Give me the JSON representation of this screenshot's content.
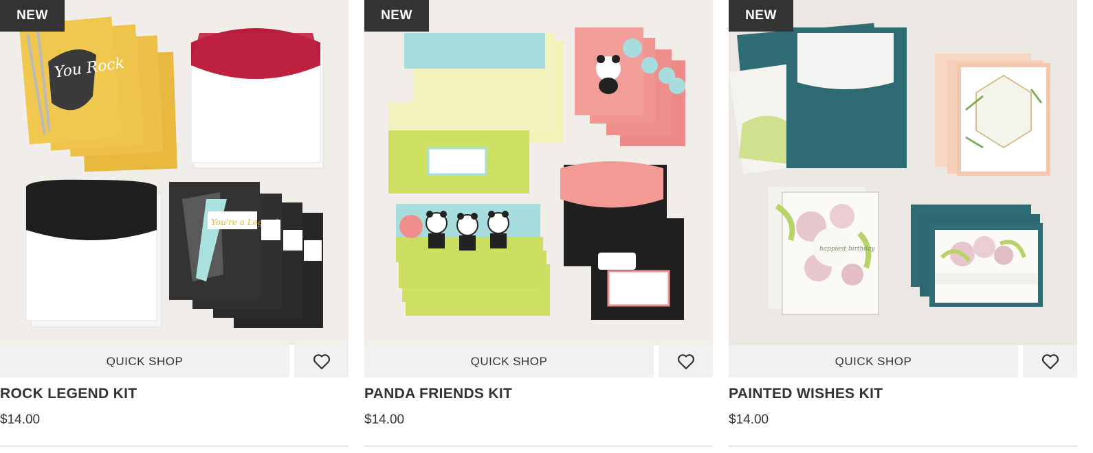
{
  "products": [
    {
      "badge": "NEW",
      "quick_shop": "QUICK SHOP",
      "name": "ROCK LEGEND KIT",
      "price": "$14.00"
    },
    {
      "badge": "NEW",
      "quick_shop": "QUICK SHOP",
      "name": "PANDA FRIENDS KIT",
      "price": "$14.00"
    },
    {
      "badge": "NEW",
      "quick_shop": "QUICK SHOP",
      "name": "PAINTED WISHES KIT",
      "price": "$14.00"
    }
  ],
  "icons": {
    "wishlist": "heart-outline-icon"
  },
  "colors": {
    "badge_bg": "#333333",
    "button_bg": "#f1f1f1",
    "text": "#333333"
  },
  "artwork": {
    "rock_legend": {
      "card_text_1": "You Rock",
      "card_text_2": "You're a Legend"
    },
    "painted_wishes": {
      "card_text": "happiest birthday"
    }
  }
}
